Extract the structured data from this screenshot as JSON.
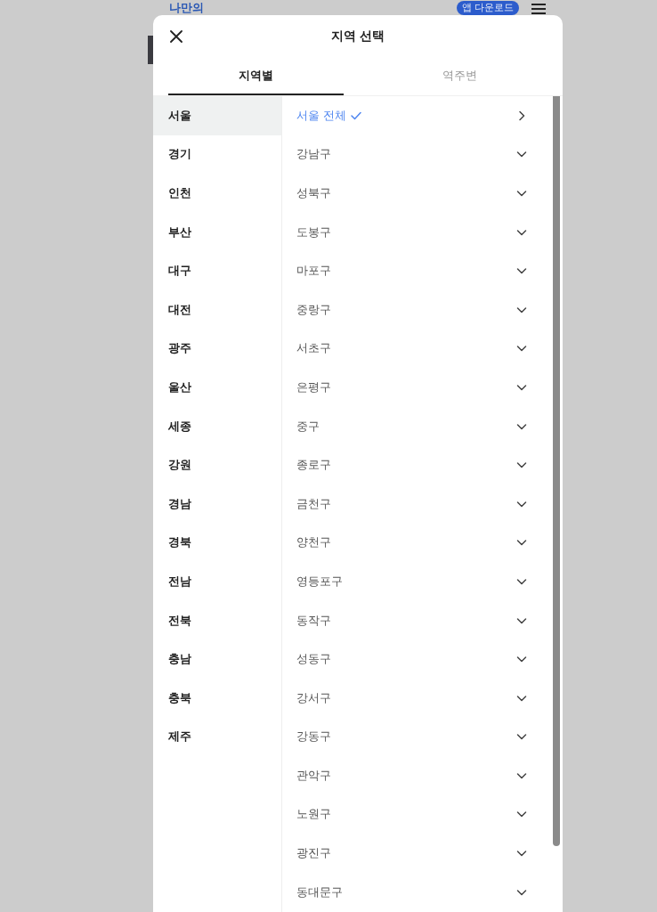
{
  "background_page": {
    "logo": "나만의",
    "download_button": "앱 다운로드"
  },
  "modal": {
    "title": "지역 선택"
  },
  "tabs": [
    {
      "label": "지역별",
      "selected": true
    },
    {
      "label": "역주변",
      "selected": false
    }
  ],
  "regions": [
    {
      "label": "서울",
      "selected": true
    },
    {
      "label": "경기",
      "selected": false
    },
    {
      "label": "인천",
      "selected": false
    },
    {
      "label": "부산",
      "selected": false
    },
    {
      "label": "대구",
      "selected": false
    },
    {
      "label": "대전",
      "selected": false
    },
    {
      "label": "광주",
      "selected": false
    },
    {
      "label": "울산",
      "selected": false
    },
    {
      "label": "세종",
      "selected": false
    },
    {
      "label": "강원",
      "selected": false
    },
    {
      "label": "경남",
      "selected": false
    },
    {
      "label": "경북",
      "selected": false
    },
    {
      "label": "전남",
      "selected": false
    },
    {
      "label": "전북",
      "selected": false
    },
    {
      "label": "충남",
      "selected": false
    },
    {
      "label": "충북",
      "selected": false
    },
    {
      "label": "제주",
      "selected": false
    }
  ],
  "districts": [
    {
      "label": "서울 전체",
      "kind": "all",
      "selected": true
    },
    {
      "label": "강남구",
      "kind": "district",
      "selected": false
    },
    {
      "label": "성북구",
      "kind": "district",
      "selected": false
    },
    {
      "label": "도봉구",
      "kind": "district",
      "selected": false
    },
    {
      "label": "마포구",
      "kind": "district",
      "selected": false
    },
    {
      "label": "중랑구",
      "kind": "district",
      "selected": false
    },
    {
      "label": "서초구",
      "kind": "district",
      "selected": false
    },
    {
      "label": "은평구",
      "kind": "district",
      "selected": false
    },
    {
      "label": "중구",
      "kind": "district",
      "selected": false
    },
    {
      "label": "종로구",
      "kind": "district",
      "selected": false
    },
    {
      "label": "금천구",
      "kind": "district",
      "selected": false
    },
    {
      "label": "양천구",
      "kind": "district",
      "selected": false
    },
    {
      "label": "영등포구",
      "kind": "district",
      "selected": false
    },
    {
      "label": "동작구",
      "kind": "district",
      "selected": false
    },
    {
      "label": "성동구",
      "kind": "district",
      "selected": false
    },
    {
      "label": "강서구",
      "kind": "district",
      "selected": false
    },
    {
      "label": "강동구",
      "kind": "district",
      "selected": false
    },
    {
      "label": "관악구",
      "kind": "district",
      "selected": false
    },
    {
      "label": "노원구",
      "kind": "district",
      "selected": false
    },
    {
      "label": "광진구",
      "kind": "district",
      "selected": false
    },
    {
      "label": "동대문구",
      "kind": "district",
      "selected": false
    }
  ]
}
